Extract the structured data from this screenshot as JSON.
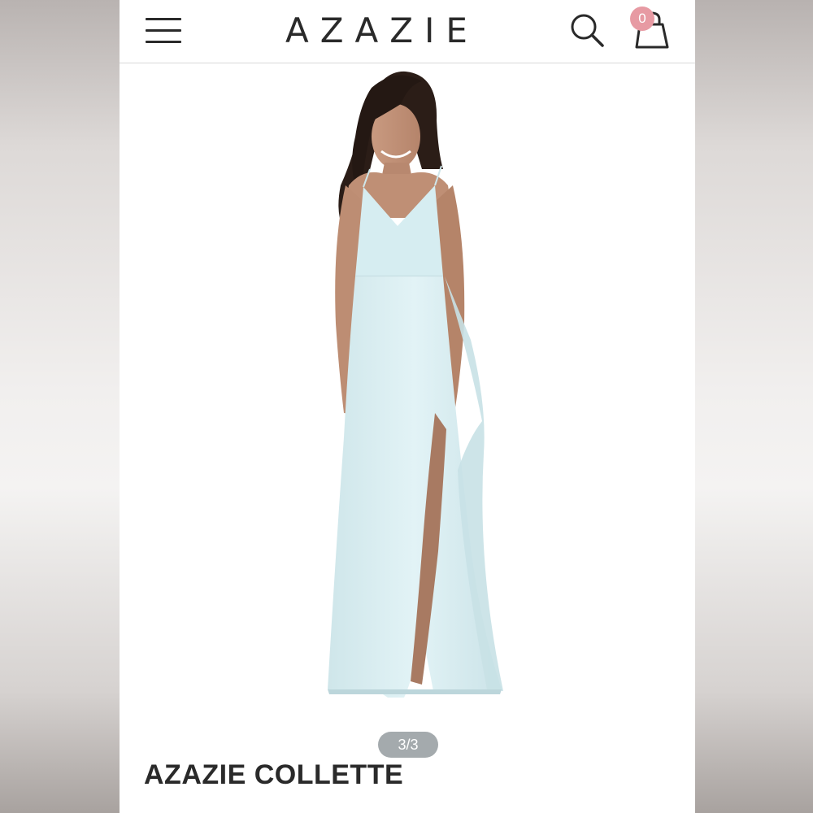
{
  "header": {
    "brand": "AZAZIE",
    "cart_count": "0",
    "icons": {
      "menu": "hamburger-menu-icon",
      "search": "search-icon",
      "cart": "shopping-bag-icon"
    }
  },
  "gallery": {
    "pager": "3/3",
    "current": 3,
    "total": 3
  },
  "product": {
    "title": "AZAZIE COLLETTE"
  },
  "colors": {
    "dress": "#d8eef2",
    "badge": "#e79aa3",
    "text": "#2a2a2a"
  }
}
